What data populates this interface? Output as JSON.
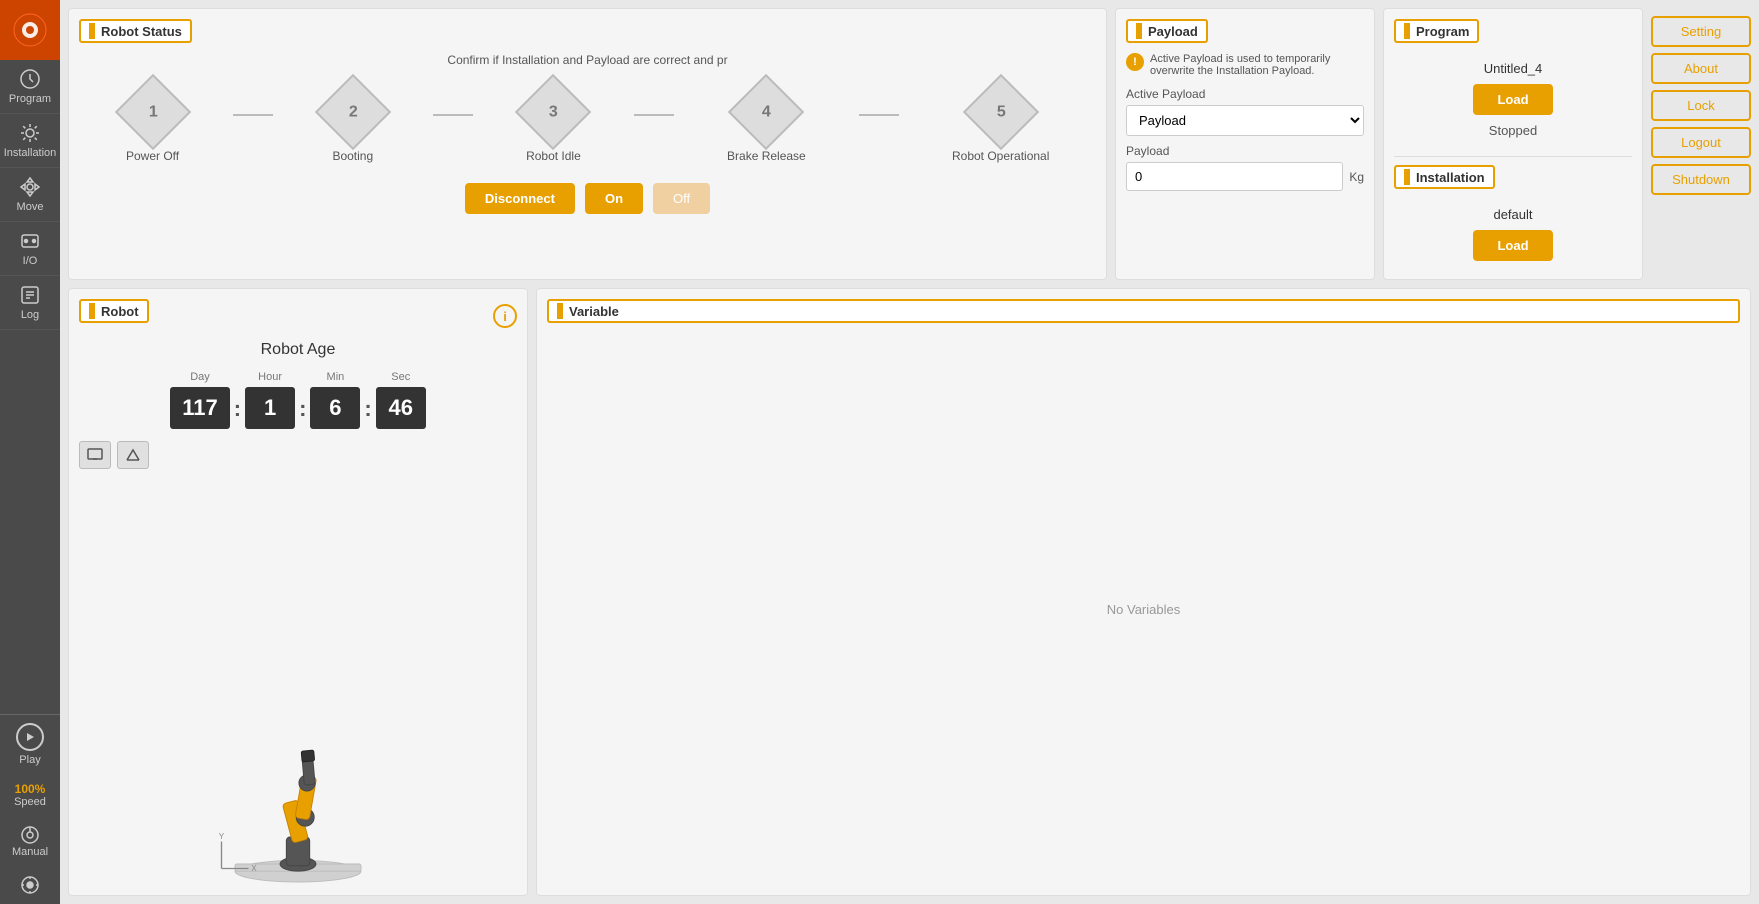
{
  "sidebar": {
    "logo_icon": "robot-logo",
    "items": [
      {
        "label": "Program",
        "icon": "program-icon"
      },
      {
        "label": "Installation",
        "icon": "installation-icon"
      },
      {
        "label": "Move",
        "icon": "move-icon"
      },
      {
        "label": "I/O",
        "icon": "io-icon"
      },
      {
        "label": "Log",
        "icon": "log-icon"
      }
    ],
    "bottom_items": [
      {
        "label": "Play",
        "icon": "play-icon"
      },
      {
        "label": "Speed",
        "sublabel": "100%",
        "icon": "speed-icon"
      },
      {
        "label": "Manual",
        "icon": "manual-icon"
      },
      {
        "label": "",
        "icon": "settings-icon"
      }
    ]
  },
  "robot_status": {
    "title": "Robot Status",
    "confirm_text": "Confirm if Installation and Payload are correct and pr",
    "steps": [
      {
        "number": "1",
        "label": "Power Off"
      },
      {
        "number": "2",
        "label": "Booting"
      },
      {
        "number": "3",
        "label": "Robot Idle"
      },
      {
        "number": "4",
        "label": "Brake Release"
      },
      {
        "number": "5",
        "label": "Robot Operational"
      }
    ],
    "disconnect_btn": "Disconnect",
    "on_btn": "On",
    "off_btn": "Off"
  },
  "payload": {
    "title": "Payload",
    "warning_text": "Active Payload is used to temporarily overwrite the Installation Payload.",
    "active_payload_label": "Active Payload",
    "active_payload_value": "Payload",
    "payload_label": "Payload",
    "payload_value": "0",
    "payload_unit": "Kg",
    "dropdown_options": [
      "Payload"
    ]
  },
  "program": {
    "title": "Program",
    "file_name": "Untitled_4",
    "load_btn": "Load",
    "status": "Stopped"
  },
  "installation": {
    "title": "Installation",
    "file_name": "default",
    "load_btn": "Load"
  },
  "right_buttons": {
    "setting": "Setting",
    "about": "About",
    "lock": "Lock",
    "logout": "Logout",
    "shutdown": "Shutdown"
  },
  "robot_panel": {
    "title": "Robot",
    "age_title": "Robot Age",
    "day_label": "Day",
    "hour_label": "Hour",
    "min_label": "Min",
    "sec_label": "Sec",
    "day_value": "117",
    "hour_value": "1",
    "min_value": "6",
    "sec_value": "46"
  },
  "variable_panel": {
    "title": "Variable",
    "no_variables": "No Variables"
  },
  "speed": {
    "label": "Speed",
    "value": "100%"
  }
}
